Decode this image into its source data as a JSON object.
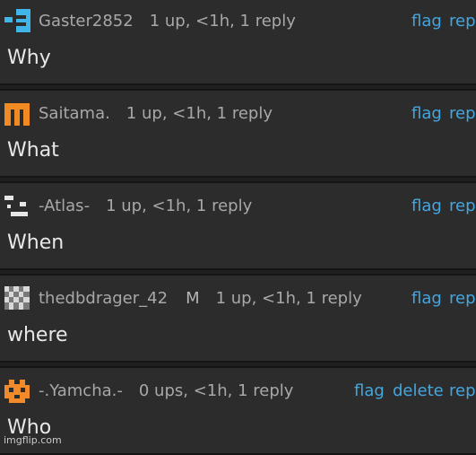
{
  "comments": [
    {
      "user": "Gaster2852",
      "badge": "",
      "stats": "1 up, <1h, 1 reply",
      "text": "Why",
      "actions": [
        "flag",
        "rep"
      ],
      "avatar_icon": "blue-pixel-avatar",
      "avatar_color": "#3fb5ea"
    },
    {
      "user": "Saitama.",
      "badge": "",
      "stats": "1 up, <1h, 1 reply",
      "text": "What",
      "actions": [
        "flag",
        "rep"
      ],
      "avatar_icon": "orange-m-avatar",
      "avatar_color": "#f28a24"
    },
    {
      "user": "-Atlas-",
      "badge": "",
      "stats": "1 up, <1h, 1 reply",
      "text": "When",
      "actions": [
        "flag",
        "rep"
      ],
      "avatar_icon": "white-pixel-avatar",
      "avatar_color": "#e6e6e6"
    },
    {
      "user": "thedbdrager_42",
      "badge": "M",
      "stats": "1 up, <1h, 1 reply",
      "text": "where",
      "actions": [
        "flag",
        "rep"
      ],
      "avatar_icon": "checker-avatar",
      "avatar_color": "#d9d9d9"
    },
    {
      "user": "-.Yamcha.-",
      "badge": "",
      "stats": "0 ups, <1h, 1 reply",
      "text": "Who",
      "actions": [
        "flag",
        "delete",
        "rep"
      ],
      "avatar_icon": "orange-cat-avatar",
      "avatar_color": "#f08a2a"
    }
  ],
  "watermark": "imgflip.com",
  "colors": {
    "background": "#2c2c2c",
    "link": "#45a6df",
    "text": "#e8e8e8",
    "meta": "#a8a8a8"
  }
}
